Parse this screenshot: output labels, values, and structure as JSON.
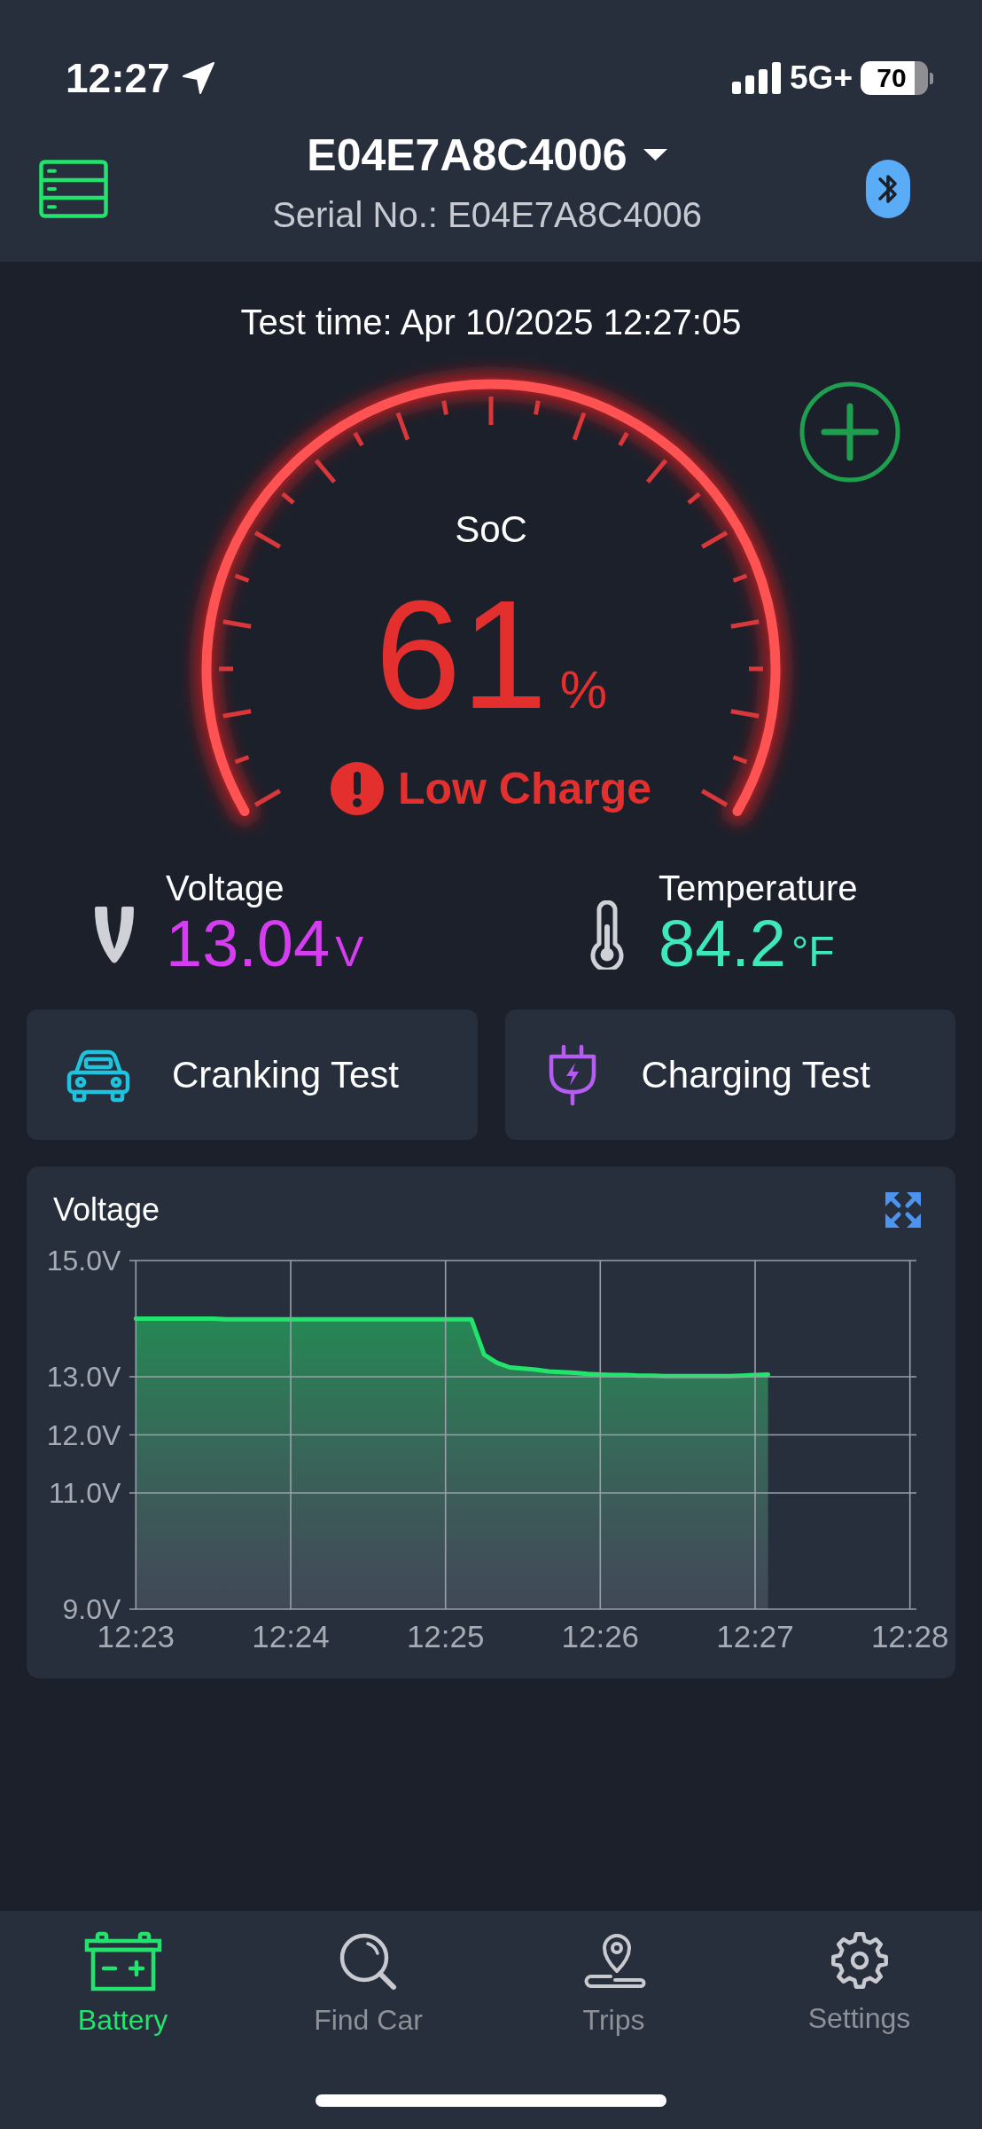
{
  "status_bar": {
    "time": "12:27",
    "network": "5G+",
    "battery": "70"
  },
  "header": {
    "device": "E04E7A8C4006",
    "serial": "Serial No.: E04E7A8C4006"
  },
  "test_time": "Test time: Apr 10/2025 12:27:05",
  "gauge": {
    "label": "SoC",
    "value": "61",
    "unit": "%",
    "status": "Low Charge",
    "alert": true
  },
  "readings": [
    {
      "kind": "voltage",
      "label": "Voltage",
      "value": "13.04",
      "unit": "V",
      "color": "#d63cf0"
    },
    {
      "kind": "temperature",
      "label": "Temperature",
      "value": "84.2",
      "unit": "°F",
      "color": "#3ee8b9"
    }
  ],
  "tests": [
    {
      "kind": "cranking",
      "label": "Cranking Test"
    },
    {
      "kind": "charging",
      "label": "Charging Test"
    }
  ],
  "voltage_chart": {
    "chart_data": {
      "type": "area",
      "title": "Voltage",
      "grid": true,
      "categories": [
        "12:23",
        null,
        null,
        null,
        null,
        null,
        null,
        null,
        null,
        null,
        null,
        null,
        "12:24",
        null,
        null,
        null,
        null,
        null,
        null,
        null,
        null,
        null,
        null,
        null,
        "12:25",
        null,
        null,
        null,
        null,
        null,
        null,
        null,
        null,
        null,
        null,
        null,
        "12:26",
        null,
        null,
        null,
        null,
        null,
        null,
        null,
        null,
        null,
        null,
        null,
        "12:27",
        null,
        null,
        null,
        null,
        null,
        null,
        null,
        null,
        null,
        null,
        null,
        "12:28"
      ],
      "series": [
        {
          "color": "#22e36b",
          "values": [
            14.0,
            14.0,
            14.0,
            14.0,
            14.0,
            14.0,
            14.0,
            13.99,
            13.99,
            13.99,
            13.99,
            13.99,
            13.99,
            13.99,
            13.99,
            13.99,
            13.99,
            13.99,
            13.99,
            13.99,
            13.99,
            13.99,
            13.99,
            13.99,
            13.99,
            13.99,
            13.99,
            13.38,
            13.24,
            13.16,
            13.14,
            13.12,
            13.09,
            13.08,
            13.07,
            13.05,
            13.04,
            13.03,
            13.03,
            13.02,
            13.02,
            13.01,
            13.01,
            13.01,
            13.01,
            13.01,
            13.01,
            13.02,
            13.03,
            13.04,
            null,
            null,
            null,
            null,
            null,
            null,
            null,
            null,
            null,
            null,
            null
          ]
        }
      ],
      "ylim": [
        9,
        15
      ],
      "yticks": [
        {
          "value": 9,
          "label": "9.0V"
        },
        {
          "value": 11,
          "label": "11.0V"
        },
        {
          "value": 12,
          "label": "12.0V"
        },
        {
          "value": 13,
          "label": "13.0V"
        },
        {
          "value": 15,
          "label": "15.0V"
        }
      ]
    }
  },
  "tabs": [
    {
      "kind": "battery",
      "label": "Battery",
      "selected": true
    },
    {
      "kind": "search",
      "label": "Find Car",
      "selected": false
    },
    {
      "kind": "trips",
      "label": "Trips",
      "selected": false
    },
    {
      "kind": "settings",
      "label": "Settings",
      "selected": false
    }
  ]
}
